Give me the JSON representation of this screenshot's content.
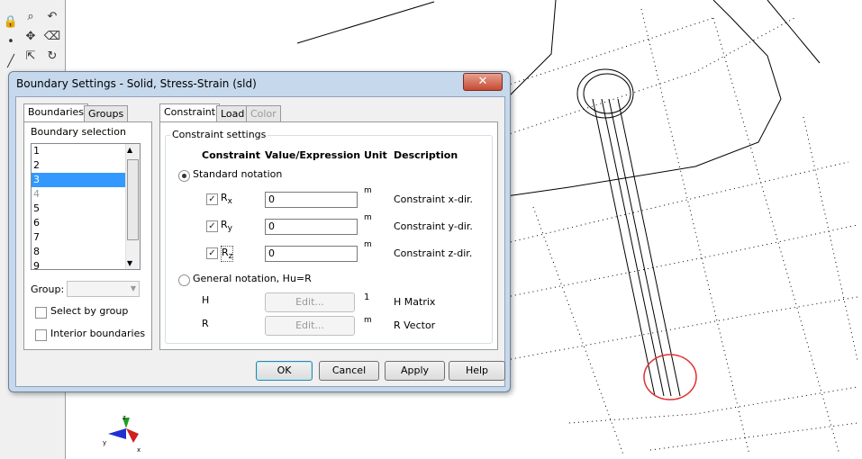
{
  "dialog": {
    "title": "Boundary Settings - Solid, Stress-Strain (sld)",
    "close_glyph": "✕",
    "left_tabs": [
      "Boundaries",
      "Groups"
    ],
    "boundary_selection_label": "Boundary selection",
    "boundaries": [
      "1",
      "2",
      "3",
      "4",
      "5",
      "6",
      "7",
      "8",
      "9"
    ],
    "selected_boundary": "3",
    "group_label": "Group:",
    "select_by_group": "Select by group",
    "interior_boundaries": "Interior boundaries",
    "right_tabs": [
      "Constraint",
      "Load",
      "Color"
    ],
    "constraint_settings": "Constraint settings",
    "headers": {
      "constraint": "Constraint",
      "value": "Value/Expression",
      "unit": "Unit",
      "description": "Description"
    },
    "standard_notation": "Standard notation",
    "rows": [
      {
        "symbol": "R",
        "sub": "x",
        "value": "0",
        "unit": "m",
        "description": "Constraint x-dir."
      },
      {
        "symbol": "R",
        "sub": "y",
        "value": "0",
        "unit": "m",
        "description": "Constraint y-dir."
      },
      {
        "symbol": "R",
        "sub": "z",
        "value": "0",
        "unit": "m",
        "description": "Constraint z-dir."
      }
    ],
    "general_notation": "General notation, Hu=R",
    "h_label": "H",
    "h_unit": "1",
    "h_description": "H Matrix",
    "r_label": "R",
    "r_unit": "m",
    "r_description": "R Vector",
    "edit_label": "Edit...",
    "buttons": {
      "ok": "OK",
      "cancel": "Cancel",
      "apply": "Apply",
      "help": "Help"
    }
  },
  "colors": {
    "accent": "#3399ff",
    "highlight_circle": "#e03030"
  },
  "icons": [
    "zoom-icon",
    "pan-icon",
    "lock-icon",
    "select-icon",
    "eraser-icon",
    "axis-triad-icon"
  ]
}
